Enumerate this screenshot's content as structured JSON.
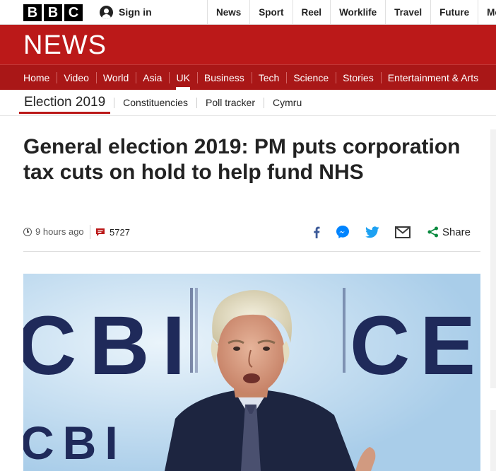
{
  "brand": {
    "logo_letters": [
      "B",
      "B",
      "C"
    ],
    "section_name": "NEWS",
    "signin_label": "Sign in"
  },
  "top_nav": [
    "News",
    "Sport",
    "Reel",
    "Worklife",
    "Travel",
    "Future",
    "More"
  ],
  "main_nav": {
    "items": [
      "Home",
      "Video",
      "World",
      "Asia",
      "UK",
      "Business",
      "Tech",
      "Science",
      "Stories",
      "Entertainment & Arts"
    ],
    "active": "UK"
  },
  "sub_nav": {
    "section": "Election 2019",
    "links": [
      "Constituencies",
      "Poll tracker",
      "Cymru"
    ]
  },
  "article": {
    "headline": "General election 2019: PM puts corporation tax cuts on hold to help fund NHS",
    "timestamp": "9 hours ago",
    "comment_count": "5727",
    "share_label": "Share",
    "share_icons": [
      "facebook-icon",
      "messenger-icon",
      "twitter-icon",
      "email-icon",
      "share-icon"
    ]
  },
  "hero_image": {
    "sign_text": [
      "CBI",
      "CE",
      "CBI"
    ]
  },
  "colors": {
    "masthead_red": "#bb1919",
    "nav_red": "#a91717",
    "facebook_blue": "#3b5998",
    "messenger_blue": "#0084ff",
    "twitter_blue": "#1da1f2",
    "share_green": "#0a8a3f",
    "comment_red": "#bb1919"
  }
}
